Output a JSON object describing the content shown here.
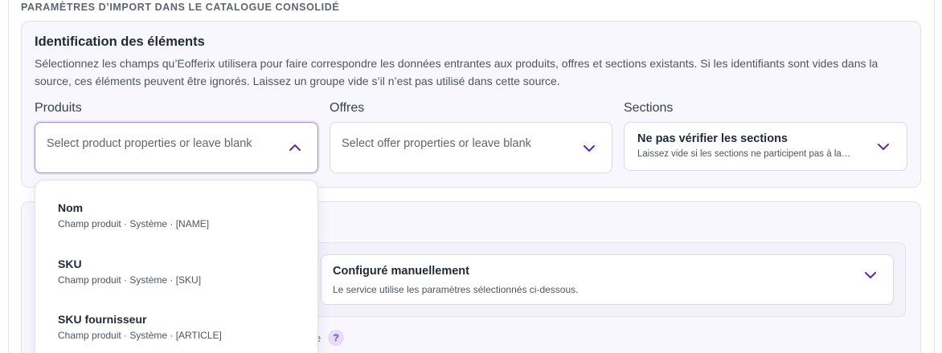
{
  "section_heading": "PARAMÈTRES D’IMPORT DANS LE CATALOGUE CONSOLIDÉ",
  "identification": {
    "title": "Identification des éléments",
    "description": "Sélectionnez les champs qu’Eofferix utilisera pour faire correspondre les données entrantes aux produits, offres et sections existants. Si les identifiants sont vides dans la source, ces éléments peuvent être ignorés. Laissez un groupe vide s’il n’est pas utilisé dans cette source."
  },
  "fields": {
    "products": {
      "label": "Produits",
      "placeholder": "Select product properties or leave blank",
      "open": true
    },
    "offers": {
      "label": "Offres",
      "placeholder": "Select offer properties or leave blank"
    },
    "sections": {
      "label": "Sections",
      "selected_title": "Ne pas vérifier les sections",
      "selected_subtitle": "Laissez vide si les sections ne participent pas à la…"
    }
  },
  "mode_select": {
    "title": "Configuré manuellement",
    "subtitle": "Le service utilise les paramètres sélectionnés ci-dessous."
  },
  "help": {
    "peek_text": "e",
    "badge": "?"
  },
  "dropdown_options": [
    {
      "title": "Nom",
      "subtitle": "Champ produit · Système · [NAME]"
    },
    {
      "title": "SKU",
      "subtitle": "Champ produit · Système · [SKU]"
    },
    {
      "title": "SKU fournisseur",
      "subtitle": "Champ produit · Système · [ARTICLE]"
    }
  ],
  "colors": {
    "accent": "#5b2ab5",
    "card_bg": "#f8f7fd",
    "border": "#e5e0f0"
  }
}
